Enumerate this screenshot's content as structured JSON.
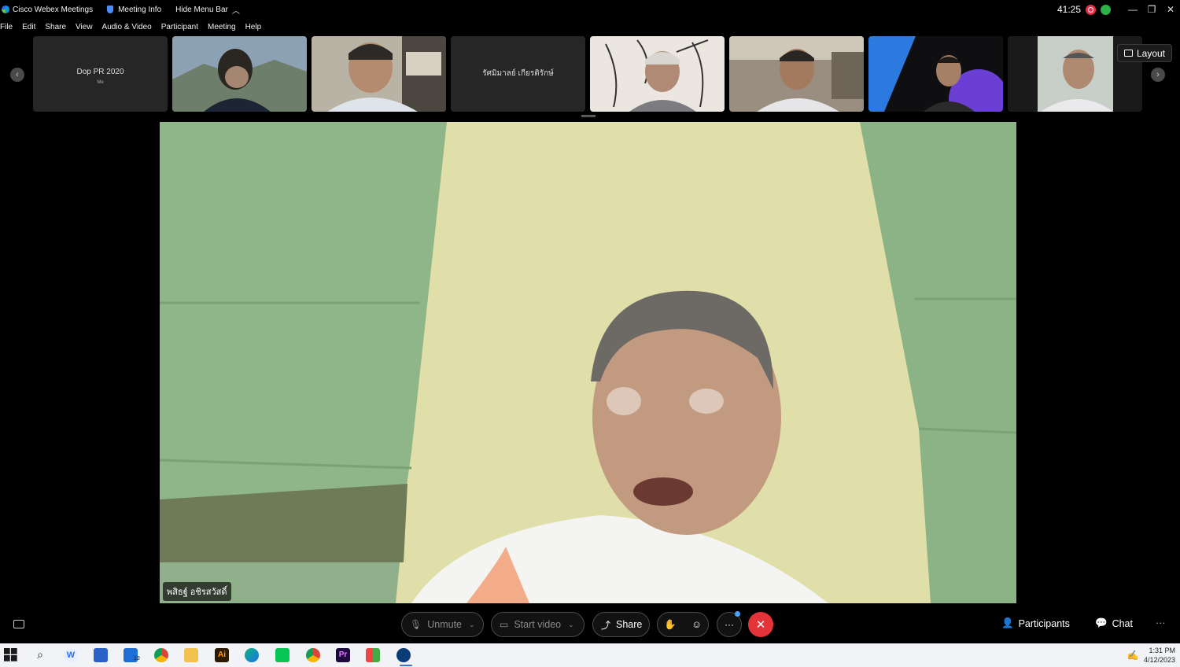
{
  "titlebar": {
    "app_name": "Cisco Webex Meetings",
    "meeting_info": "Meeting Info",
    "hide_menu": "Hide Menu Bar",
    "timer": "41:25"
  },
  "menu": [
    "File",
    "Edit",
    "Share",
    "View",
    "Audio & Video",
    "Participant",
    "Meeting",
    "Help"
  ],
  "filmstrip": {
    "tiles": [
      {
        "name": "Dop PR 2020",
        "sub": "Me"
      },
      {
        "name": ""
      },
      {
        "name": ""
      },
      {
        "name": "รัศมิมาลย์ เกียรติรักษ์"
      },
      {
        "name": ""
      },
      {
        "name": ""
      },
      {
        "name": ""
      },
      {
        "name": ""
      }
    ],
    "layout_label": "Layout"
  },
  "main_video": {
    "speaker_name": "พสิธฐ์ อชิรสวัสดิ์"
  },
  "controls": {
    "unmute": "Unmute",
    "start_video": "Start video",
    "share": "Share",
    "participants": "Participants",
    "chat": "Chat"
  },
  "taskbar": {
    "time": "1:31 PM",
    "date": "4/12/2023",
    "mail_badge": "19"
  }
}
